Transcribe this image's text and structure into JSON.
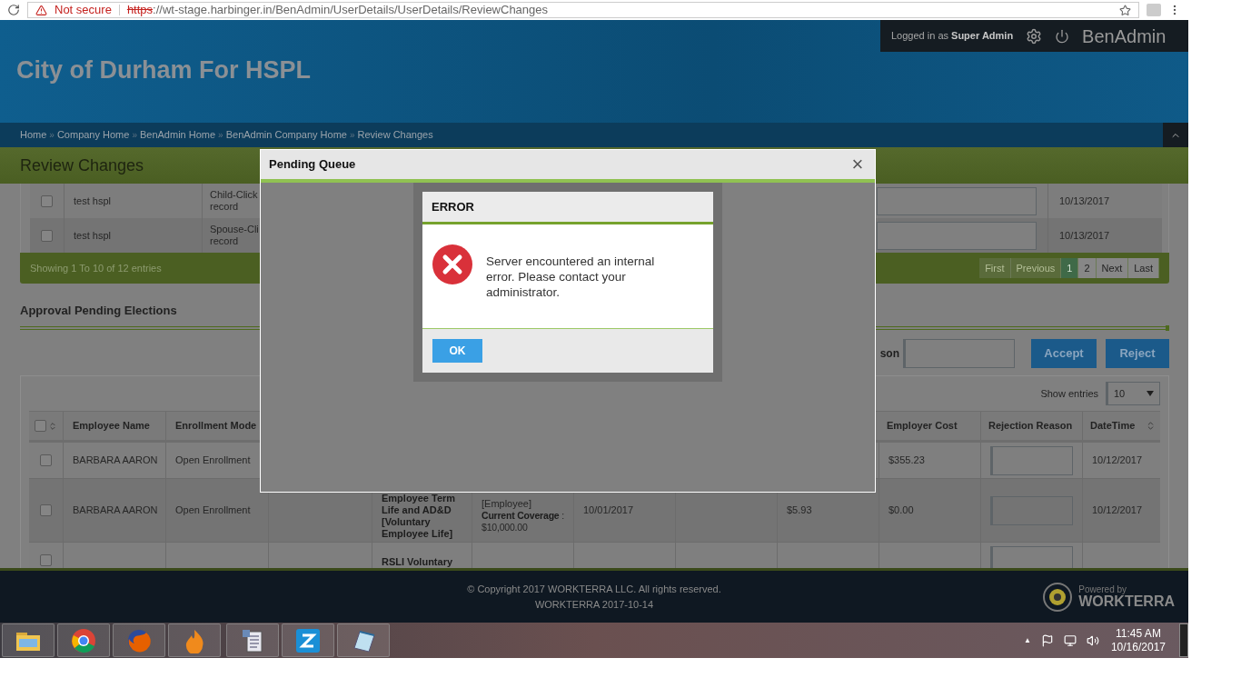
{
  "browser": {
    "security": "Not secure",
    "url_scheme": "https",
    "url_rest": "://wt-stage.harbinger.in/BenAdmin/UserDetails/UserDetails/ReviewChanges"
  },
  "header": {
    "title": "City of Durham For HSPL",
    "logged_in_prefix": "Logged in as",
    "user": "Super Admin",
    "app": "BenAdmin"
  },
  "breadcrumb": {
    "separator": "»",
    "items": [
      "Home",
      "Company Home",
      "BenAdmin Home",
      "BenAdmin Company Home",
      "Review Changes"
    ]
  },
  "page_title": "Review Changes",
  "changes_table": {
    "rows": [
      {
        "checked": false,
        "name": "test hspl",
        "type": "Child-Click",
        "type_line2": "record",
        "date": "10/13/2017"
      },
      {
        "checked": false,
        "name": "test hspl",
        "type": "Spouse-Cli",
        "type_line2": "record",
        "date": "10/13/2017"
      }
    ],
    "info": "Showing 1 To 10 of 12 entries",
    "pages": [
      {
        "label": "First",
        "selected": false,
        "disabled": true
      },
      {
        "label": "Previous",
        "selected": false,
        "disabled": true
      },
      {
        "label": "1",
        "selected": true,
        "disabled": false
      },
      {
        "label": "2",
        "selected": false,
        "disabled": false
      },
      {
        "label": "Next",
        "selected": false,
        "disabled": false
      },
      {
        "label": "Last",
        "selected": false,
        "disabled": false
      }
    ]
  },
  "elections": {
    "title": "Approval Pending Elections",
    "reason_label": "son",
    "accept": "Accept",
    "reject": "Reject",
    "show_entries": "Show entries",
    "page_size": "10",
    "columns": {
      "employee_name": "Employee Name",
      "enrollment_mode": "Enrollment Mode",
      "employer_cost": "Employer Cost",
      "rejection_reason": "Rejection Reason",
      "datetime": "DateTime"
    },
    "all_checked": false,
    "rows": [
      {
        "checked": false,
        "name": "BARBARA AARON",
        "mode": "Open Enrollment",
        "employer_cost": "$355.23",
        "date": "10/12/2017"
      },
      {
        "checked": false,
        "name": "BARBARA AARON",
        "mode": "Open Enrollment",
        "plan": "Employee Term Life and AD&D [Voluntary Employee Life]",
        "covered": "[Employee]",
        "coverage": "**Current Coverage** : $10,000.00",
        "effective": "10/01/2017",
        "employee_cost": "$5.93",
        "employer_cost": "$0.00",
        "date": "10/12/2017"
      },
      {
        "checked": false,
        "plan": "RSLI Voluntary"
      }
    ]
  },
  "modal": {
    "title": "Pending Queue",
    "close": "×"
  },
  "error": {
    "title": "ERROR",
    "message": "Server encountered an internal error. Please contact your administrator.",
    "ok": "OK"
  },
  "footer": {
    "copyright": "© Copyright 2017 WORKTERRA LLC. All rights reserved.",
    "version": "WORKTERRA 2017-10-14",
    "powered_by": "Powered by",
    "brand": "WORKTERRA"
  },
  "taskbar": {
    "apps": [
      {
        "kind": "folder"
      },
      {
        "kind": "chrome"
      },
      {
        "kind": "firefox"
      },
      {
        "kind": "flame"
      },
      {
        "kind": "document"
      },
      {
        "kind": "z"
      },
      {
        "kind": "notepad"
      }
    ],
    "tray_arrow": "▲",
    "time": "11:45 AM",
    "date": "10/16/2017"
  }
}
